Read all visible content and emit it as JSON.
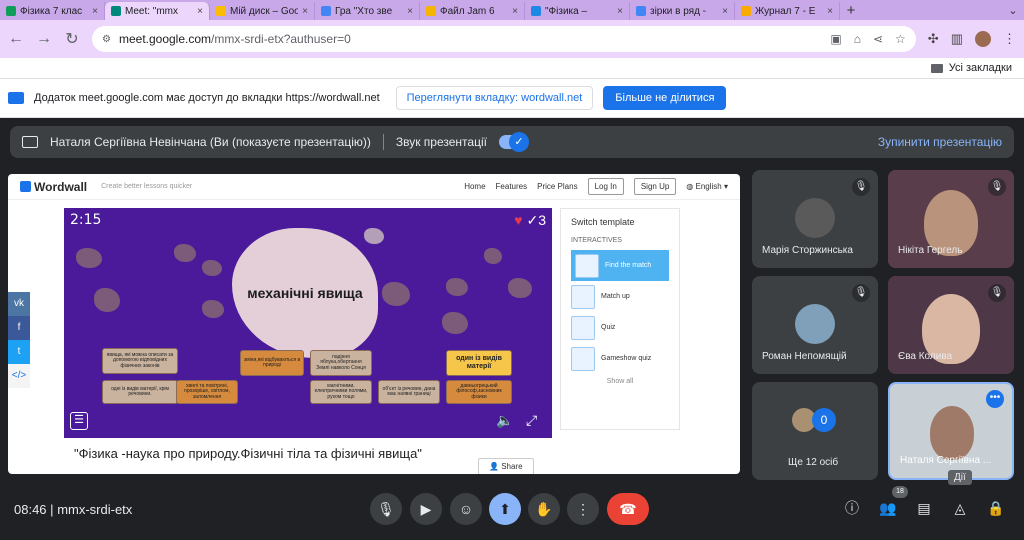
{
  "browser": {
    "tabs": [
      {
        "title": "Фізика 7 клас",
        "color": "#0f9d58",
        "active": false
      },
      {
        "title": "Meet: \"mmx",
        "color": "#00897b",
        "active": true
      },
      {
        "title": "Мій диск – Goo",
        "color": "#fbbc04",
        "active": false
      },
      {
        "title": "Гра \"Хто зве",
        "color": "#4285f4",
        "active": false
      },
      {
        "title": "Файл Jam 6",
        "color": "#f4b400",
        "active": false
      },
      {
        "title": "\"Фізика –",
        "color": "#1e88e5",
        "active": false
      },
      {
        "title": "зірки в ряд -",
        "color": "#4285f4",
        "active": false
      },
      {
        "title": "Журнал 7 - Е",
        "color": "#f9ab00",
        "active": false
      }
    ],
    "url_host": "meet.google.com",
    "url_path": "/mmx-srdi-etx?authuser=0",
    "bookmarks_label": "Усі закладки"
  },
  "infobar": {
    "text": "Додаток meet.google.com має доступ до вкладки https://wordwall.net",
    "view_tab_button": "Переглянути вкладку: wordwall.net",
    "stop_sharing_button": "Більше не ділитися"
  },
  "presenting": {
    "presenter_text": "Наталя Сергіївна Невінчана (Ви (показуєте презентацію))",
    "audio_label": "Звук презентації",
    "stop_label": "Зупинити презентацію"
  },
  "wordwall": {
    "logo": "Wordwall",
    "tagline": "Create better lessons quicker",
    "nav": [
      "Home",
      "Features",
      "Price Plans"
    ],
    "login": "Log In",
    "signup": "Sign Up",
    "language": "English",
    "timer": "2:15",
    "lives": "3",
    "center_text": "механічні явища",
    "cards": [
      "явища, які можна описати за допомогою відповідних фізичних законів",
      "зміни,які відбуваються в природі",
      "падіння яблука,обертання Землі навколо Сонця",
      "один із видів матерії",
      "одні із видів матерії, крім речовини.",
      "хвилі та повітряні, прозоріше, світлом, заломлення",
      "магнітними, електричними полями, рухом тощо",
      "об'єкт із речовин, дана має наявні границі",
      "давньогрецький філософ,засновник фізики"
    ],
    "side_title": "Switch template",
    "side_subtitle": "INTERACTIVES",
    "templates": [
      "Find the match",
      "Match up",
      "Quiz",
      "Gameshow quiz"
    ],
    "show_all": "Show all",
    "activity_title": "\"Фізика -наука про природу.Фізичні тіла та фізичні явища\"",
    "share": "Share"
  },
  "participants": [
    {
      "name": "Марія Сторжинська",
      "muted": true,
      "type": "avatar",
      "avatar_color": "#5a5a5a"
    },
    {
      "name": "Нікіта Гергель",
      "muted": true,
      "type": "video"
    },
    {
      "name": "Роман Непомящій",
      "muted": true,
      "type": "avatar",
      "avatar_color": "#7fa0b8"
    },
    {
      "name": "Єва Колива",
      "muted": true,
      "type": "video"
    },
    {
      "name": "Ще 12 осіб",
      "count": "0",
      "type": "more"
    },
    {
      "name": "Наталя Сергіївна ...",
      "type": "self"
    }
  ],
  "tooltip": "Дії",
  "bottom": {
    "time": "08:46",
    "separator": "|",
    "meeting_code": "mmx-srdi-etx",
    "participant_count": "18"
  },
  "colors": {
    "meet_bg": "#202124",
    "accent": "#8ab4f8",
    "end_call": "#ea4335",
    "tab_strip": "#c8a8e9"
  }
}
